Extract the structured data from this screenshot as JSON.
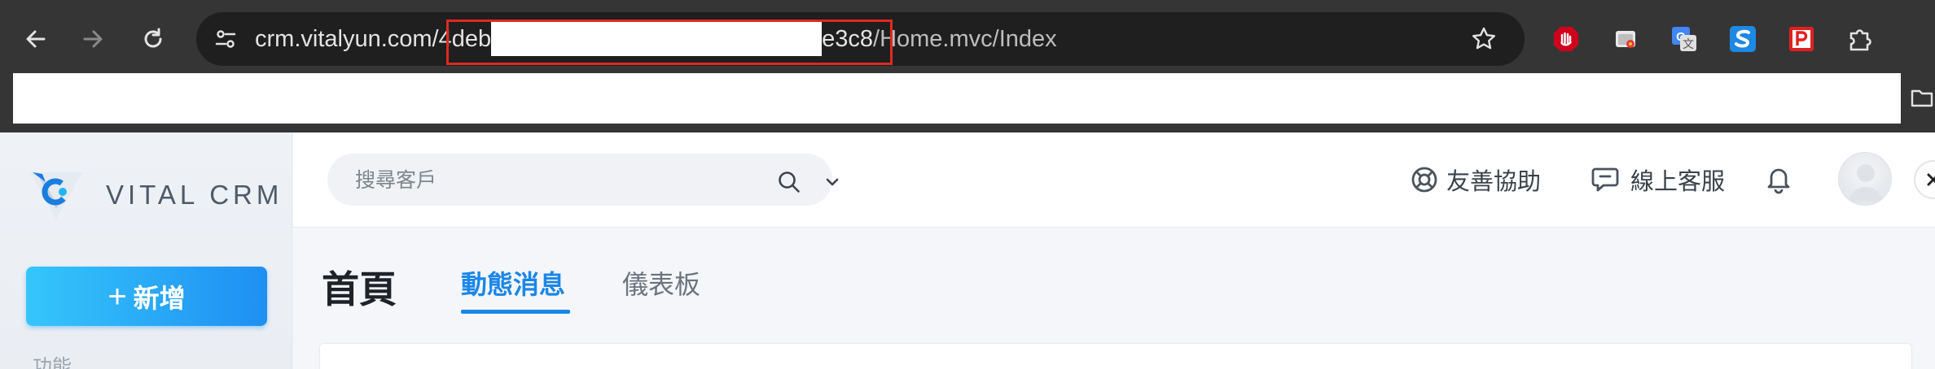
{
  "browser": {
    "url_host": "crm.vitalyun.com/",
    "url_prefix": "4deb",
    "url_suffix": "e3c8",
    "url_path": "/Home.mvc/Index",
    "icons": {
      "back": "back-arrow-icon",
      "forward": "forward-arrow-icon",
      "reload": "reload-icon",
      "site_info": "site-settings-icon",
      "bookmark": "star-icon",
      "extensions": [
        "ublock-icon",
        "tab-manager-icon",
        "google-translate-icon",
        "s-extension-icon",
        "p-extension-icon",
        "puzzle-extensions-icon"
      ],
      "folder": "folder-icon"
    },
    "highlight_color": "#e02a20"
  },
  "sidebar": {
    "logo_text": "VITAL CRM",
    "new_button_plus": "+",
    "new_button_label": "新增",
    "section_label": "功能"
  },
  "topbar": {
    "search_placeholder": "搜尋客戶",
    "help_label": "友善協助",
    "support_label": "線上客服"
  },
  "page": {
    "title": "首頁",
    "tabs": [
      {
        "label": "動態消息",
        "active": true
      },
      {
        "label": "儀表板",
        "active": false
      }
    ]
  },
  "colors": {
    "accent": "#1a86e8",
    "button_gradient_start": "#35c6fb",
    "button_gradient_end": "#1e8ff2"
  }
}
